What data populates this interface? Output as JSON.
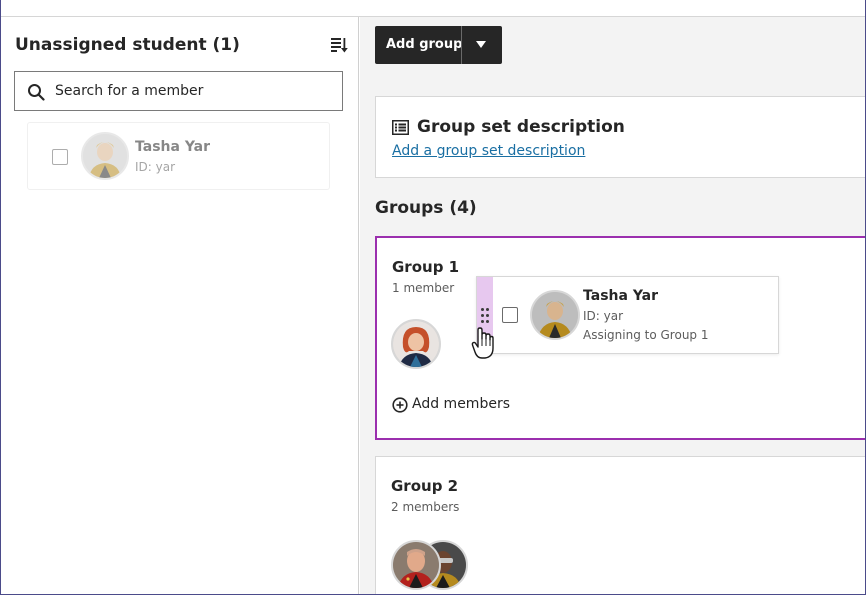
{
  "left_panel": {
    "title": "Unassigned student (1)",
    "sort_icon": "sort-descending-icon",
    "search": {
      "placeholder": "Search for a member",
      "icon": "search-icon"
    },
    "students": [
      {
        "name": "Tasha Yar",
        "id_label": "ID: yar",
        "checked": false
      }
    ]
  },
  "toolbar": {
    "add_group_label": "Add group",
    "dropdown_icon": "caret-down-icon"
  },
  "description_card": {
    "title": "Group set description",
    "link": "Add a group set description",
    "icon": "list-icon"
  },
  "groups_header": "Groups (4)",
  "groups": [
    {
      "name": "Group 1",
      "count": "1 member",
      "add_label": "Add members",
      "highlighted": true
    },
    {
      "name": "Group 2",
      "count": "2 members"
    }
  ],
  "drag_card": {
    "name": "Tasha Yar",
    "id_label": "ID: yar",
    "status": "Assigning to Group 1",
    "handle_icon": "drag-handle-icon",
    "cursor_icon": "grab-hand-icon"
  },
  "colors": {
    "accent_purple": "#9b2fae",
    "drag_handle_bg": "#e7c8ef",
    "link_blue": "#1a6fa3",
    "button_dark": "#262626",
    "panel_bg": "#f3f3f3"
  }
}
